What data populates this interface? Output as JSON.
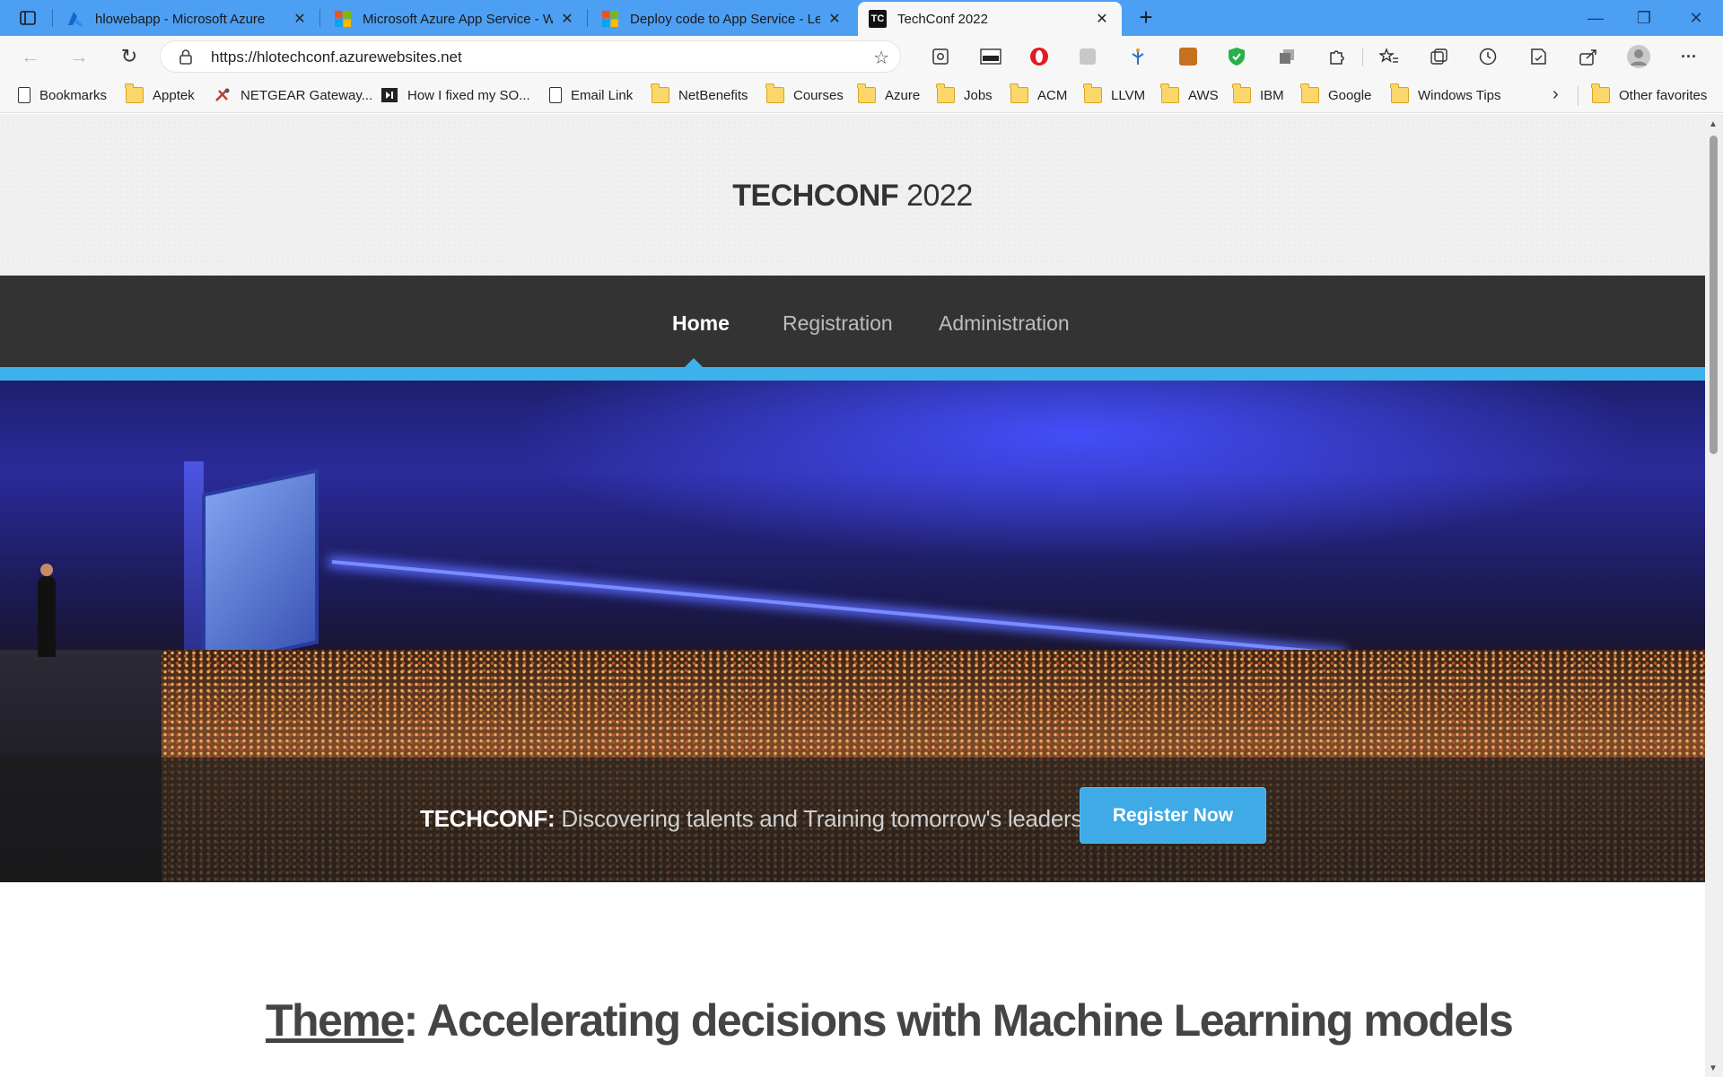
{
  "browser": {
    "tabs": [
      {
        "title": "hlowebapp - Microsoft Azure",
        "icon": "azure-icon",
        "active": false
      },
      {
        "title": "Microsoft Azure App Service - W",
        "icon": "microsoft-icon",
        "active": false
      },
      {
        "title": "Deploy code to App Service - Le",
        "icon": "microsoft-icon",
        "active": false
      },
      {
        "title": "TechConf 2022",
        "icon": "tc-icon",
        "active": true
      }
    ],
    "tc_favicon_text": "TC",
    "tab_close_glyph": "✕",
    "new_tab_glyph": "+",
    "window_controls": {
      "minimize": "—",
      "restore": "❐",
      "close": "✕"
    },
    "nav": {
      "back": "←",
      "forward": "→",
      "refresh": "↻"
    },
    "url": "https://hlotechconf.azurewebsites.net",
    "more_glyph": "···",
    "bookmarks": [
      {
        "label": "Bookmarks",
        "type": "page"
      },
      {
        "label": "Apptek",
        "type": "folder"
      },
      {
        "label": "NETGEAR Gateway...",
        "type": "tool"
      },
      {
        "label": "How I fixed my SO...",
        "type": "media"
      },
      {
        "label": "Email Link",
        "type": "page"
      },
      {
        "label": "NetBenefits",
        "type": "folder"
      },
      {
        "label": "Courses",
        "type": "folder"
      },
      {
        "label": "Azure",
        "type": "folder"
      },
      {
        "label": "Jobs",
        "type": "folder"
      },
      {
        "label": "ACM",
        "type": "folder"
      },
      {
        "label": "LLVM",
        "type": "folder"
      },
      {
        "label": "AWS",
        "type": "folder"
      },
      {
        "label": "IBM",
        "type": "folder"
      },
      {
        "label": "Google",
        "type": "folder"
      },
      {
        "label": "Windows Tips",
        "type": "folder"
      }
    ],
    "bookmarks_overflow": "›",
    "other_favorites": "Other favorites"
  },
  "site": {
    "title_bold": "TECHCONF",
    "title_rest": " 2022",
    "nav": {
      "home": "Home",
      "registration": "Registration",
      "administration": "Administration"
    },
    "tagline_bold": "TECHCONF:",
    "tagline_rest": " Discovering talents and Training tomorrow's leaders",
    "register_button": "Register Now",
    "theme_label": "Theme",
    "theme_text": ": Accelerating decisions with Machine Learning models"
  },
  "colors": {
    "tab_strip": "#4d9ff3",
    "nav_bar": "#333333",
    "accent": "#3eb0ea",
    "button": "#3eaae6"
  }
}
